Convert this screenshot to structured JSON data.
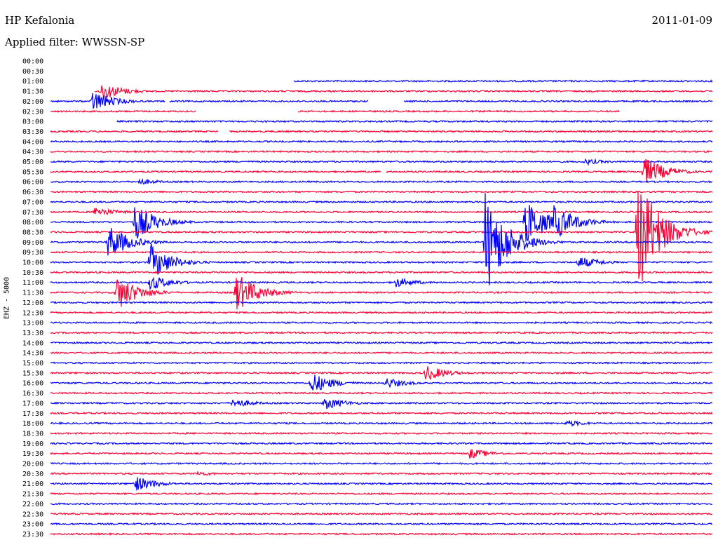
{
  "header": {
    "station": "HP Kefalonia",
    "date": "2011-01-09",
    "filter": "Applied filter: WWSSN-SP"
  },
  "channel_label": "EHZ - 5000",
  "colors": {
    "blue": "#0000ff",
    "red": "#ff0033"
  },
  "chart_data": {
    "type": "line",
    "description_kind": "seismogram helicorder",
    "time_labels": [
      "00:00",
      "00:30",
      "01:00",
      "01:30",
      "02:00",
      "02:30",
      "03:00",
      "03:30",
      "04:00",
      "04:30",
      "05:00",
      "05:30",
      "06:00",
      "06:30",
      "07:00",
      "07:30",
      "08:00",
      "08:30",
      "09:00",
      "09:30",
      "10:00",
      "10:30",
      "11:00",
      "11:30",
      "12:00",
      "12:30",
      "13:00",
      "13:30",
      "14:00",
      "14:30",
      "15:00",
      "15:30",
      "16:00",
      "16:30",
      "17:00",
      "17:30",
      "18:00",
      "18:30",
      "19:00",
      "19:30",
      "20:00",
      "20:30",
      "21:00",
      "21:30",
      "22:00",
      "22:30",
      "23:00",
      "23:30"
    ],
    "row_minutes": 30,
    "trace_start_row": 2,
    "events": [
      {
        "row": 3,
        "minute": 2.3,
        "amp": 14
      },
      {
        "row": 4,
        "minute": 1.9,
        "amp": 16
      },
      {
        "row": 10,
        "minute": 24.2,
        "amp": 5
      },
      {
        "row": 11,
        "minute": 26.9,
        "amp": 22
      },
      {
        "row": 12,
        "minute": 4.0,
        "amp": 5
      },
      {
        "row": 15,
        "minute": 2.0,
        "amp": 8
      },
      {
        "row": 16,
        "minute": 3.8,
        "amp": 28
      },
      {
        "row": 16,
        "minute": 21.5,
        "amp": 36
      },
      {
        "row": 16,
        "minute": 22.8,
        "amp": 28
      },
      {
        "row": 17,
        "minute": 26.6,
        "amp": 90
      },
      {
        "row": 18,
        "minute": 2.6,
        "amp": 26
      },
      {
        "row": 18,
        "minute": 19.7,
        "amp": 78
      },
      {
        "row": 20,
        "minute": 4.5,
        "amp": 28
      },
      {
        "row": 20,
        "minute": 23.9,
        "amp": 10
      },
      {
        "row": 22,
        "minute": 4.5,
        "amp": 12
      },
      {
        "row": 22,
        "minute": 15.6,
        "amp": 8
      },
      {
        "row": 23,
        "minute": 3.0,
        "amp": 26
      },
      {
        "row": 23,
        "minute": 8.4,
        "amp": 30
      },
      {
        "row": 31,
        "minute": 17.0,
        "amp": 12
      },
      {
        "row": 32,
        "minute": 11.8,
        "amp": 16
      },
      {
        "row": 32,
        "minute": 15.2,
        "amp": 8
      },
      {
        "row": 34,
        "minute": 8.2,
        "amp": 8
      },
      {
        "row": 34,
        "minute": 12.4,
        "amp": 10
      },
      {
        "row": 36,
        "minute": 23.4,
        "amp": 5
      },
      {
        "row": 39,
        "minute": 19.0,
        "amp": 8
      },
      {
        "row": 41,
        "minute": 6.6,
        "amp": 4
      },
      {
        "row": 42,
        "minute": 3.8,
        "amp": 12
      }
    ],
    "gaps": [
      {
        "row": 2,
        "from": 0,
        "to": 11
      },
      {
        "row": 3,
        "from": 0,
        "to": 2
      },
      {
        "row": 4,
        "from": 5.2,
        "to": 5.4
      },
      {
        "row": 4,
        "from": 14.4,
        "to": 16.0
      },
      {
        "row": 5,
        "from": 6.6,
        "to": 11.2
      },
      {
        "row": 5,
        "from": 25.8,
        "to": 30
      },
      {
        "row": 6,
        "from": 0,
        "to": 3.0
      },
      {
        "row": 7,
        "from": 7.6,
        "to": 8.1
      },
      {
        "row": 11,
        "from": 15.0,
        "to": 15.2
      }
    ]
  }
}
